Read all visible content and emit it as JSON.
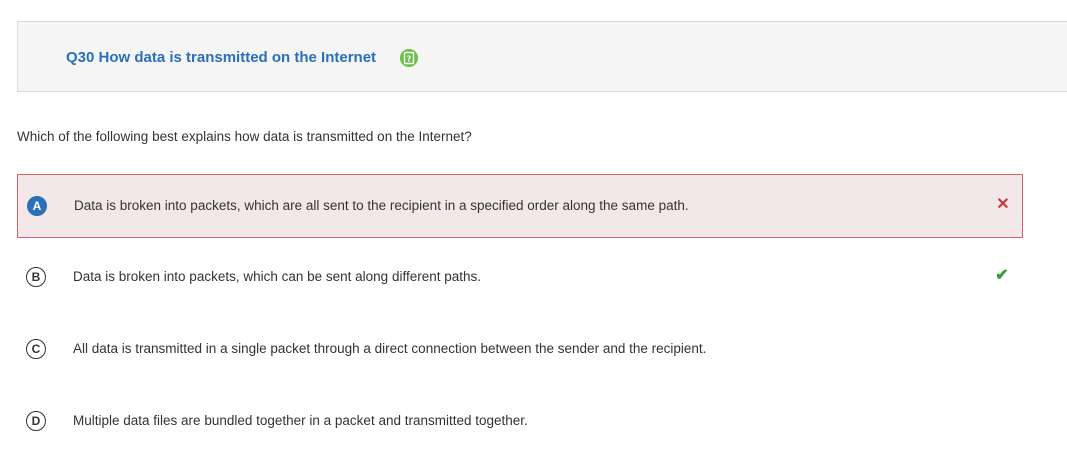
{
  "question": {
    "title": "Q30 How data is transmitted on the Internet",
    "help_icon": "flag-question-icon",
    "prompt": "Which of the following best explains how data is transmitted on the Internet?"
  },
  "options": [
    {
      "letter": "A",
      "text": "Data is broken into packets, which are all sent to the recipient in a specified order along the same path.",
      "state": "selected-wrong",
      "mark": "✕"
    },
    {
      "letter": "B",
      "text": "Data is broken into packets, which can be sent along different paths.",
      "state": "correct",
      "mark": "✔"
    },
    {
      "letter": "C",
      "text": "All data is transmitted in a single packet through a direct connection between the sender and the recipient.",
      "state": "none",
      "mark": ""
    },
    {
      "letter": "D",
      "text": "Multiple data files are bundled together in a packet and transmitted together.",
      "state": "none",
      "mark": ""
    }
  ],
  "colors": {
    "title": "#2a6fb8",
    "selected_bg": "#f3e8e9",
    "selected_border": "#d9606a",
    "wrong_mark": "#c93a3f",
    "correct_mark": "#3a9a3a",
    "help_icon": "#6cbf4a"
  }
}
